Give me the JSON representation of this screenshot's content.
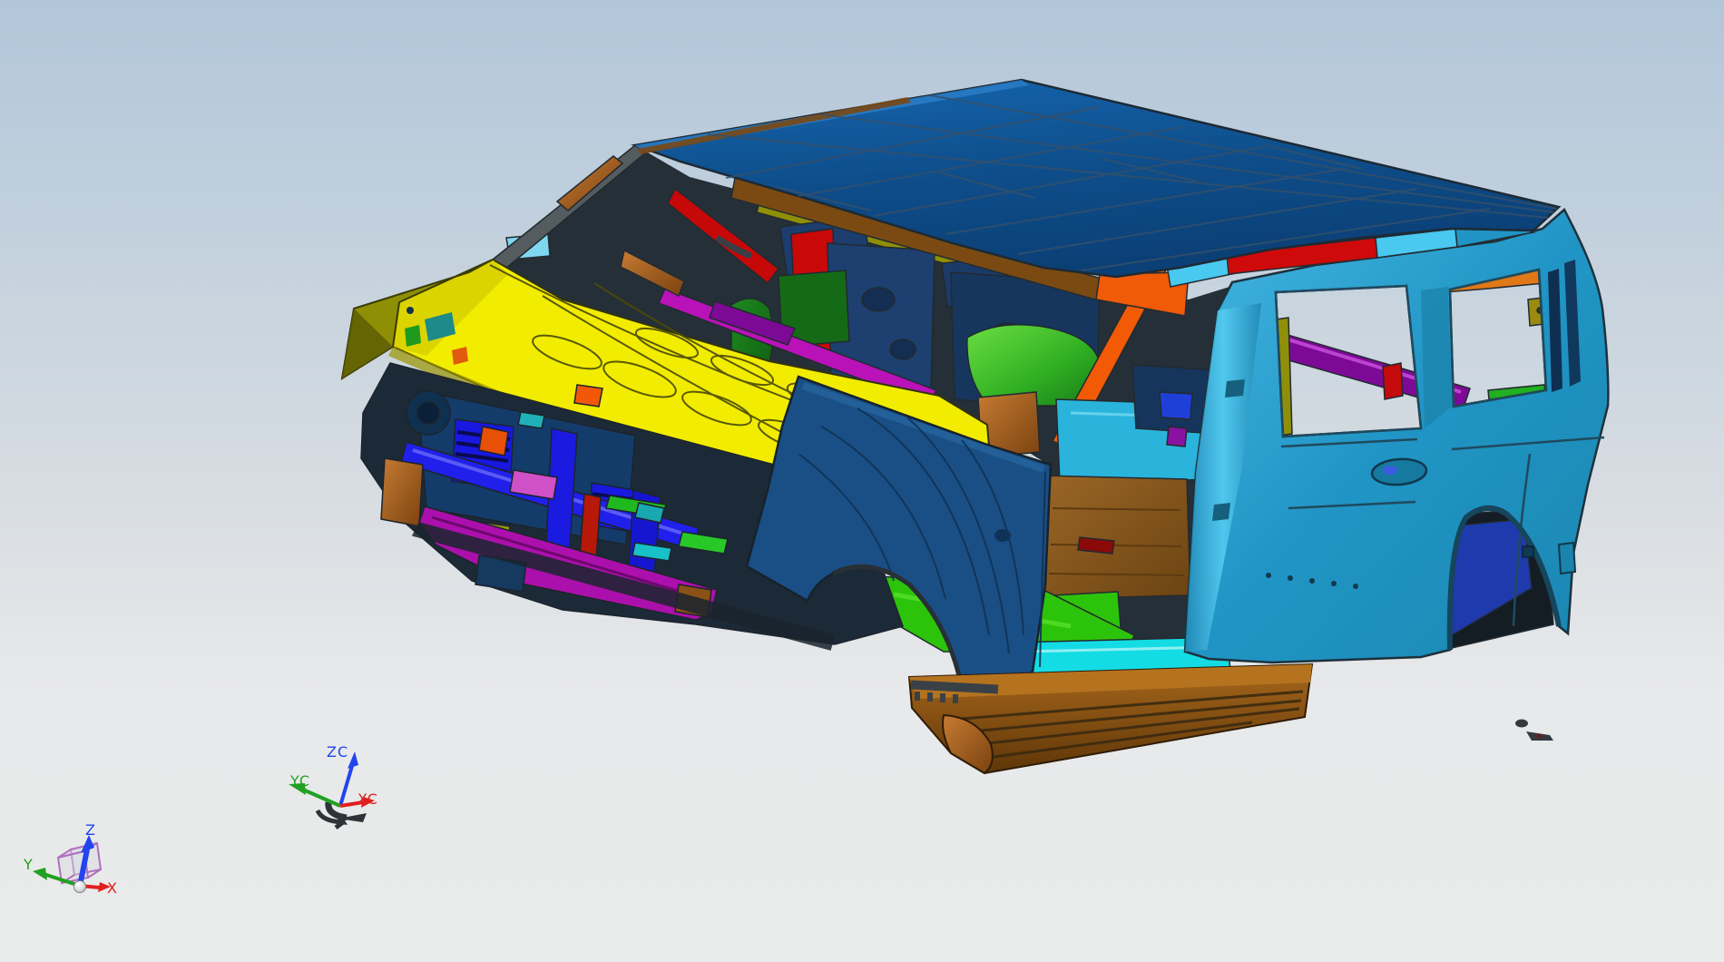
{
  "scene": {
    "background_top": "#b2c6da",
    "background_mid": "#d8dde2",
    "background_bottom": "#e8e9ea"
  },
  "palette": {
    "bg_top": "#b2c6da",
    "bg_mid": "#d8dde2",
    "bg_bottom": "#e8e9ea",
    "roof": "#0e4d8a",
    "roof_hi": "#2a7cc8",
    "body_teal": "#2095c5",
    "body_teal_dark": "#157a9e",
    "pillar_cyan": "#4cc6ee",
    "rail_cyan": "#49c8f0",
    "hood_yellow": "#f2ec00",
    "hood_line": "#4a4a08",
    "fender_navy": "#1a4f85",
    "interior_dark": "#252f38",
    "magenta": "#b412b4",
    "purple": "#7d0a96",
    "red": "#c90808",
    "orange": "#f25a06",
    "green_bright": "#2cc40a",
    "green_seat": "#2fae22",
    "blue_bright": "#1818e0",
    "navy_panel": "#1d4070",
    "brown_rail": "#7b4a12",
    "copper": "#b5731f",
    "board_brown": "#7c4a10",
    "floor_brown": "#8a5a20",
    "floor_cyan": "#2ab4dc",
    "sill_cyan": "#14dce4",
    "olive": "#8f8f06",
    "edge": "#3f474c"
  },
  "wcs_triad": {
    "z_label": "ZC",
    "y_label": "YC",
    "x_label": "XC",
    "z_color": "#2244ee",
    "y_color": "#22a022",
    "x_color": "#e02020"
  },
  "view_triad": {
    "z_label": "Z",
    "y_label": "Y",
    "x_label": "X",
    "z_color": "#2244ee",
    "y_color": "#22a022",
    "x_color": "#e02020",
    "cube_color": "#b070c0"
  }
}
